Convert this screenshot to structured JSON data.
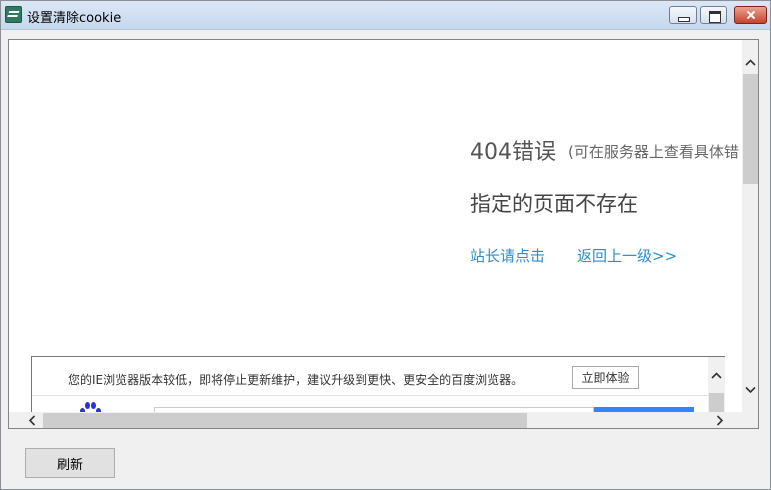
{
  "window": {
    "title": "设置清除cookie",
    "app_icon": "app-logo-icon",
    "controls": [
      "minimize-icon",
      "maximize-icon",
      "close-icon"
    ]
  },
  "page": {
    "error_title": "404错误",
    "error_hint": "(可在服务器上查看具体错",
    "error_subtitle": "指定的页面不存在",
    "link_admin": "站长请点击",
    "link_back": "返回上一级>>"
  },
  "banner": {
    "text": "您的IE浏览器版本较低，即将停止更新维护，建议升级到更快、更安全的百度浏览器。",
    "button": "立即体验",
    "logo_icon": "baidu-paw-icon"
  },
  "footer": {
    "refresh_label": "刷新"
  },
  "colors": {
    "link": "#2e8ec9",
    "close_button": "#c7432b",
    "search_button": "#3385ff"
  }
}
